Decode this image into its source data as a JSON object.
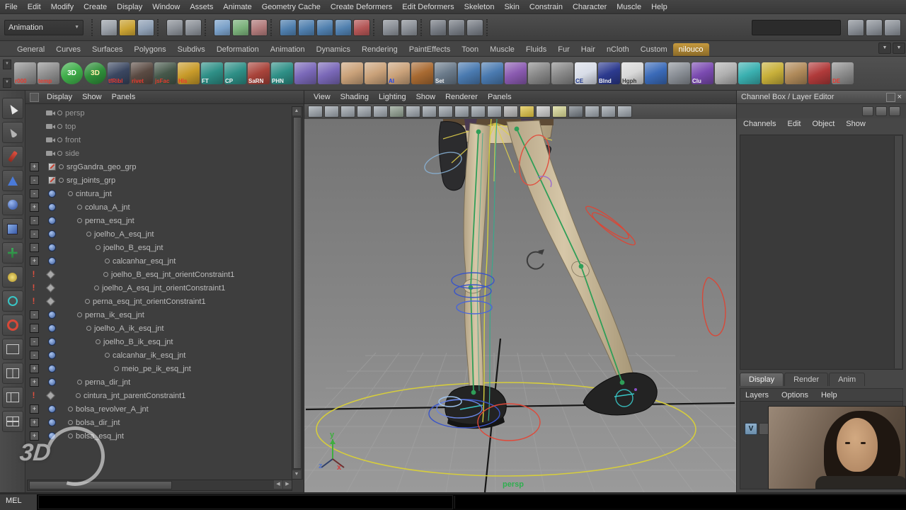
{
  "glyphs": {
    "up": "▲",
    "down": "▼",
    "left": "◀",
    "right": "▶",
    "close": "×"
  },
  "colors": {
    "panel": "#4a4a4a",
    "active_shelf_tab": "#b98a3a",
    "viewport_bg": "#868686",
    "outliner_bg": "#3e3e3e",
    "persp_label_green": "#2fae4f",
    "joint_chain_green": "#2f9e58",
    "control_blue": "#3a55c8",
    "control_red": "#e04838",
    "master_control_yellow": "#d6cd3c"
  },
  "menubar": {
    "items": [
      "File",
      "Edit",
      "Modify",
      "Create",
      "Display",
      "Window",
      "Assets",
      "Animate",
      "Geometry Cache",
      "Create Deformers",
      "Edit Deformers",
      "Skeleton",
      "Skin",
      "Constrain",
      "Character",
      "Muscle",
      "Help"
    ]
  },
  "statusline": {
    "mode": "Animation",
    "icons": [
      {
        "t": "sep",
        "n": "group-grip"
      },
      {
        "t": "btn",
        "n": "new-scene-icon",
        "bg": "#9aa0a8"
      },
      {
        "t": "btn",
        "n": "open-scene-icon",
        "bg": "#c9a233"
      },
      {
        "t": "btn",
        "n": "save-scene-icon",
        "bg": "#8fa0b5"
      },
      {
        "t": "sep",
        "n": "group-grip"
      },
      {
        "t": "btn",
        "n": "undo-icon",
        "bg": "#8a8f96"
      },
      {
        "t": "btn",
        "n": "redo-icon",
        "bg": "#8a8f96"
      },
      {
        "t": "sep",
        "n": "group-grip"
      },
      {
        "t": "btn",
        "n": "select-hierarchy-icon",
        "bg": "#7aa0c8"
      },
      {
        "t": "btn",
        "n": "select-object-icon",
        "bg": "#7ab07a"
      },
      {
        "t": "btn",
        "n": "select-component-icon",
        "bg": "#b07a7a"
      },
      {
        "t": "sep",
        "n": "group-grip"
      },
      {
        "t": "btn",
        "n": "snap-to-grid-icon",
        "bg": "#4f7fae"
      },
      {
        "t": "btn",
        "n": "snap-to-curve-icon",
        "bg": "#4f7fae"
      },
      {
        "t": "btn",
        "n": "snap-to-point-icon",
        "bg": "#4f7fae"
      },
      {
        "t": "btn",
        "n": "snap-to-plane-icon",
        "bg": "#4f7fae"
      },
      {
        "t": "btn",
        "n": "make-live-icon",
        "bg": "#b35555"
      },
      {
        "t": "sep",
        "n": "group-grip"
      },
      {
        "t": "btn",
        "n": "construction-history-icon",
        "bg": "#8a8f96"
      },
      {
        "t": "btn",
        "n": "history-toggle-icon",
        "bg": "#8a8f96"
      },
      {
        "t": "sep",
        "n": "group-grip"
      },
      {
        "t": "btn",
        "n": "render-icon",
        "bg": "#777c84"
      },
      {
        "t": "btn",
        "n": "ipr-render-icon",
        "bg": "#777c84"
      },
      {
        "t": "btn",
        "n": "render-settings-icon",
        "bg": "#777c84"
      },
      {
        "t": "sep",
        "n": "group-grip"
      }
    ],
    "right_icons": [
      {
        "n": "attribute-editor-toggle-icon",
        "bg": "#8a8f96"
      },
      {
        "n": "tool-settings-toggle-icon",
        "bg": "#8a8f96"
      },
      {
        "n": "channel-box-toggle-icon",
        "bg": "#8a8f96"
      }
    ]
  },
  "shelf": {
    "tabs": [
      {
        "label": "General",
        "state": ""
      },
      {
        "label": "Curves",
        "state": ""
      },
      {
        "label": "Surfaces",
        "state": ""
      },
      {
        "label": "Polygons",
        "state": ""
      },
      {
        "label": "Subdivs",
        "state": ""
      },
      {
        "label": "Deformation",
        "state": ""
      },
      {
        "label": "Animation",
        "state": ""
      },
      {
        "label": "Dynamics",
        "state": ""
      },
      {
        "label": "Rendering",
        "state": ""
      },
      {
        "label": "PaintEffects",
        "state": ""
      },
      {
        "label": "Toon",
        "state": ""
      },
      {
        "label": "Muscle",
        "state": ""
      },
      {
        "label": "Fluids",
        "state": ""
      },
      {
        "label": "Fur",
        "state": ""
      },
      {
        "label": "Hair",
        "state": ""
      },
      {
        "label": "nCloth",
        "state": ""
      },
      {
        "label": "Custom",
        "state": ""
      },
      {
        "label": "nilouco",
        "state": "active"
      }
    ],
    "icons": [
      {
        "label": "r000",
        "fg": "#e8392e",
        "bg": "#8d8d8d",
        "shape": ""
      },
      {
        "label": "temp",
        "fg": "#e8392e",
        "bg": "#8d8d8d",
        "shape": ""
      },
      {
        "label": "3D",
        "fg": "#ffffff",
        "bg": "#3fae4a",
        "shape": "round"
      },
      {
        "label": "3D",
        "fg": "#ffeeaa",
        "bg": "#2f8f3a",
        "shape": "round"
      },
      {
        "label": "tfRibl",
        "fg": "#e8392e",
        "bg": "#3a4660",
        "shape": ""
      },
      {
        "label": "rivet",
        "fg": "#e8392e",
        "bg": "#5a4a42",
        "shape": ""
      },
      {
        "label": "jsFac",
        "fg": "#e8392e",
        "bg": "#46584a",
        "shape": ""
      },
      {
        "label": "His",
        "fg": "#e8392e",
        "bg": "#c89b2a",
        "shape": ""
      },
      {
        "label": "FT",
        "fg": "#f2f2f2",
        "bg": "#2e8f86",
        "shape": ""
      },
      {
        "label": "CP",
        "fg": "#f2f2f2",
        "bg": "#2e8f86",
        "shape": ""
      },
      {
        "label": "SaRN",
        "fg": "#f2f2f2",
        "bg": "#a8433a",
        "shape": ""
      },
      {
        "label": "PHN",
        "fg": "#f2f2f2",
        "bg": "#2e8f86",
        "shape": ""
      },
      {
        "label": "",
        "fg": "",
        "bg": "#7a68b8",
        "shape": ""
      },
      {
        "label": "",
        "fg": "",
        "bg": "#7a68b8",
        "shape": ""
      },
      {
        "label": "",
        "fg": "",
        "bg": "#caa27a",
        "shape": ""
      },
      {
        "label": "",
        "fg": "",
        "bg": "#caa27a",
        "shape": ""
      },
      {
        "label": "AI",
        "fg": "#2244ee",
        "bg": "#caa27a",
        "shape": ""
      },
      {
        "label": "",
        "fg": "",
        "bg": "#a86a32",
        "shape": ""
      },
      {
        "label": "Set",
        "fg": "#f2f2f2",
        "bg": "#6a7a8a",
        "shape": ""
      },
      {
        "label": "",
        "fg": "",
        "bg": "#4a7ab0",
        "shape": ""
      },
      {
        "label": "",
        "fg": "",
        "bg": "#4a7ab0",
        "shape": ""
      },
      {
        "label": "",
        "fg": "",
        "bg": "#8a5ab0",
        "shape": ""
      },
      {
        "label": "",
        "fg": "",
        "bg": "#888888",
        "shape": ""
      },
      {
        "label": "",
        "fg": "",
        "bg": "#888888",
        "shape": ""
      },
      {
        "label": "CE",
        "fg": "#223a8e",
        "bg": "#d8dde8",
        "shape": ""
      },
      {
        "label": "Blnd",
        "fg": "#f2f2f2",
        "bg": "#2c3a8e",
        "shape": ""
      },
      {
        "label": "Hgph",
        "fg": "#333333",
        "bg": "#d8d8d8",
        "shape": ""
      },
      {
        "label": "",
        "fg": "",
        "bg": "#3a6ab8",
        "shape": ""
      },
      {
        "label": "",
        "fg": "",
        "bg": "#8a8f96",
        "shape": ""
      },
      {
        "label": "Clu",
        "fg": "#f2f2f2",
        "bg": "#7a4ab0",
        "shape": ""
      },
      {
        "label": "",
        "fg": "",
        "bg": "#b0b0b0",
        "shape": ""
      },
      {
        "label": "",
        "fg": "",
        "bg": "#3ab0b0",
        "shape": ""
      },
      {
        "label": "",
        "fg": "",
        "bg": "#c8b03a",
        "shape": ""
      },
      {
        "label": "",
        "fg": "",
        "bg": "#b08a5a",
        "shape": ""
      },
      {
        "label": "",
        "fg": "",
        "bg": "#b03a3a",
        "shape": ""
      },
      {
        "label": "DE",
        "fg": "#e8392e",
        "bg": "#8d8d8d",
        "shape": ""
      }
    ]
  },
  "toolbox": {
    "tools": [
      {
        "n": "select-tool",
        "kind": "k-arrow"
      },
      {
        "n": "lasso-select-tool",
        "kind": "k-lasso"
      },
      {
        "n": "paint-selection-tool",
        "kind": "k-brush"
      },
      {
        "n": "move-tool",
        "kind": "k-cone"
      },
      {
        "n": "rotate-tool",
        "kind": "k-sphere"
      },
      {
        "n": "scale-tool",
        "kind": "k-cube"
      },
      {
        "n": "universal-manipulator-tool",
        "kind": "k-axis"
      },
      {
        "n": "soft-modification-tool",
        "kind": "k-softmod"
      },
      {
        "n": "show-manipulator-tool",
        "kind": "k-manip"
      },
      {
        "n": "last-tool-used",
        "kind": "k-ring"
      },
      {
        "n": "single-pane-layout-button",
        "kind": "k-pane1"
      },
      {
        "n": "two-pane-layout-button",
        "kind": "k-pane2"
      },
      {
        "n": "persp-outliner-layout-button",
        "kind": "k-pane3"
      },
      {
        "n": "four-pane-layout-button",
        "kind": "k-pane4"
      }
    ]
  },
  "outliner": {
    "menus": [
      "Display",
      "Show",
      "Panels"
    ],
    "items": [
      {
        "label": "persp",
        "indent": 0,
        "icon": "camera",
        "gutter": "",
        "gutter_type": ""
      },
      {
        "label": "top",
        "indent": 0,
        "icon": "camera",
        "gutter": "",
        "gutter_type": ""
      },
      {
        "label": "front",
        "indent": 0,
        "icon": "camera",
        "gutter": "",
        "gutter_type": ""
      },
      {
        "label": "side",
        "indent": 0,
        "icon": "camera",
        "gutter": "",
        "gutter_type": ""
      },
      {
        "label": "srgGandra_geo_grp",
        "indent": 0,
        "icon": "transform",
        "gutter": "+",
        "gutter_type": "expand"
      },
      {
        "label": "srg_joints_grp",
        "indent": 0,
        "icon": "transform",
        "gutter": "-",
        "gutter_type": "expand"
      },
      {
        "label": "cintura_jnt",
        "indent": 1,
        "icon": "joint",
        "gutter": "-",
        "gutter_type": "expand"
      },
      {
        "label": "coluna_A_jnt",
        "indent": 2,
        "icon": "joint",
        "gutter": "+",
        "gutter_type": "expand"
      },
      {
        "label": "perna_esq_jnt",
        "indent": 2,
        "icon": "joint",
        "gutter": "-",
        "gutter_type": "expand"
      },
      {
        "label": "joelho_A_esq_jnt",
        "indent": 3,
        "icon": "joint",
        "gutter": "-",
        "gutter_type": "expand"
      },
      {
        "label": "joelho_B_esq_jnt",
        "indent": 4,
        "icon": "joint",
        "gutter": "-",
        "gutter_type": "expand"
      },
      {
        "label": "calcanhar_esq_jnt",
        "indent": 5,
        "icon": "joint",
        "gutter": "+",
        "gutter_type": "expand"
      },
      {
        "label": "joelho_B_esq_jnt_orientConstraint1",
        "indent": 5,
        "icon": "constraint",
        "gutter": "!",
        "gutter_type": "alert"
      },
      {
        "label": "joelho_A_esq_jnt_orientConstraint1",
        "indent": 4,
        "icon": "constraint",
        "gutter": "!",
        "gutter_type": "alert"
      },
      {
        "label": "perna_esq_jnt_orientConstraint1",
        "indent": 3,
        "icon": "constraint",
        "gutter": "!",
        "gutter_type": "alert"
      },
      {
        "label": "perna_ik_esq_jnt",
        "indent": 2,
        "icon": "joint",
        "gutter": "-",
        "gutter_type": "expand"
      },
      {
        "label": "joelho_A_ik_esq_jnt",
        "indent": 3,
        "icon": "joint",
        "gutter": "-",
        "gutter_type": "expand"
      },
      {
        "label": "joelho_B_ik_esq_jnt",
        "indent": 4,
        "icon": "joint",
        "gutter": "-",
        "gutter_type": "expand"
      },
      {
        "label": "calcanhar_ik_esq_jnt",
        "indent": 5,
        "icon": "joint",
        "gutter": "-",
        "gutter_type": "expand"
      },
      {
        "label": "meio_pe_ik_esq_jnt",
        "indent": 6,
        "icon": "joint",
        "gutter": "+",
        "gutter_type": "expand"
      },
      {
        "label": "perna_dir_jnt",
        "indent": 2,
        "icon": "joint",
        "gutter": "+",
        "gutter_type": "expand"
      },
      {
        "label": "cintura_jnt_parentConstraint1",
        "indent": 2,
        "icon": "constraint",
        "gutter": "!",
        "gutter_type": "alert"
      },
      {
        "label": "bolsa_revolver_A_jnt",
        "indent": 1,
        "icon": "joint",
        "gutter": "+",
        "gutter_type": "expand"
      },
      {
        "label": "bolsa_dir_jnt",
        "indent": 1,
        "icon": "joint",
        "gutter": "+",
        "gutter_type": "expand"
      },
      {
        "label": "bolsa_esq_jnt",
        "indent": 1,
        "icon": "joint",
        "gutter": "+",
        "gutter_type": "expand"
      }
    ]
  },
  "viewport": {
    "menus": [
      "View",
      "Shading",
      "Lighting",
      "Show",
      "Renderer",
      "Panels"
    ],
    "bar_icons": [
      {
        "n": "select-camera-icon",
        "bg": "#98a0a8"
      },
      {
        "n": "lock-camera-icon",
        "bg": "#98a0a8"
      },
      {
        "n": "camera-attributes-icon",
        "bg": "#98a0a8"
      },
      {
        "n": "bookmarks-icon",
        "bg": "#98a0a8"
      },
      {
        "n": "image-plane-icon",
        "bg": "#98a0a8"
      },
      {
        "n": "grid-display-icon",
        "bg": "#8a9a8a"
      },
      {
        "n": "film-gate-icon",
        "bg": "#98a0a8"
      },
      {
        "n": "resolution-gate-icon",
        "bg": "#98a0a8"
      },
      {
        "n": "gate-mask-icon",
        "bg": "#98a0a8"
      },
      {
        "n": "field-chart-icon",
        "bg": "#98a0a8"
      },
      {
        "n": "safe-action-icon",
        "bg": "#98a0a8"
      },
      {
        "n": "safe-title-icon",
        "bg": "#98a0a8"
      },
      {
        "n": "wireframe-icon",
        "bg": "#b0b0b0"
      },
      {
        "n": "smooth-shade-icon",
        "bg": "#e0c23a"
      },
      {
        "n": "textured-icon",
        "bg": "#c8c8c8"
      },
      {
        "n": "use-lights-icon",
        "bg": "#d8d890"
      },
      {
        "n": "shadows-icon",
        "bg": "#707880"
      },
      {
        "n": "xray-icon",
        "bg": "#98a0a8"
      },
      {
        "n": "camera-tools-icon",
        "bg": "#98a0a8"
      },
      {
        "n": "isolate-select-icon",
        "bg": "#98a0a8"
      }
    ],
    "camera_label": "persp",
    "axis": {
      "y": "y",
      "z": "z",
      "x": "x"
    }
  },
  "channelbox": {
    "title": "Channel Box / Layer Editor",
    "menus": [
      "Channels",
      "Edit",
      "Object",
      "Show"
    ],
    "manip_icons": [
      {
        "n": "channel-speed-icon"
      },
      {
        "n": "channel-manip-icon"
      },
      {
        "n": "channel-pin-icon"
      }
    ],
    "layer_tabs": [
      {
        "label": "Display",
        "state": "active"
      },
      {
        "label": "Render",
        "state": ""
      },
      {
        "label": "Anim",
        "state": ""
      }
    ],
    "layer_menus": [
      "Layers",
      "Options",
      "Help"
    ],
    "visibility_toggle": "V"
  },
  "melbar": {
    "label": "MEL"
  },
  "watermark": {
    "text": "3D"
  }
}
